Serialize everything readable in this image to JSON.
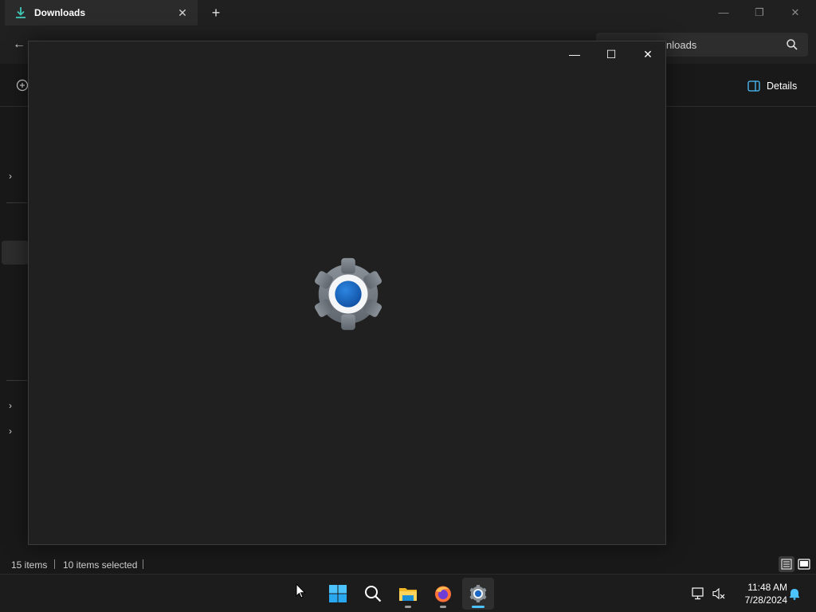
{
  "explorer": {
    "tab": {
      "title": "Downloads",
      "close_glyph": "✕"
    },
    "add_tab_glyph": "+",
    "window_controls": {
      "minimize": "—",
      "restore": "❐",
      "close": "✕"
    },
    "back_glyph": "←",
    "search_text": "nloads",
    "commandbar": {
      "details_label": "Details"
    },
    "nav_chevron": "›",
    "status": {
      "items": "15 items",
      "selected": "10 items selected"
    }
  },
  "settings_window": {
    "controls": {
      "minimize": "—",
      "maximize": "☐",
      "close": "✕"
    },
    "splash_icon": "settings-gear-icon"
  },
  "taskbar": {
    "items": [
      "start-icon",
      "search-icon",
      "file-explorer-icon",
      "firefox-icon",
      "settings-icon"
    ],
    "clock": {
      "time": "11:48 AM",
      "date": "7/28/2024"
    }
  },
  "colors": {
    "accent": "#4cc2ff",
    "gear_blue": "#1a67c4",
    "window_bg": "#202020"
  }
}
